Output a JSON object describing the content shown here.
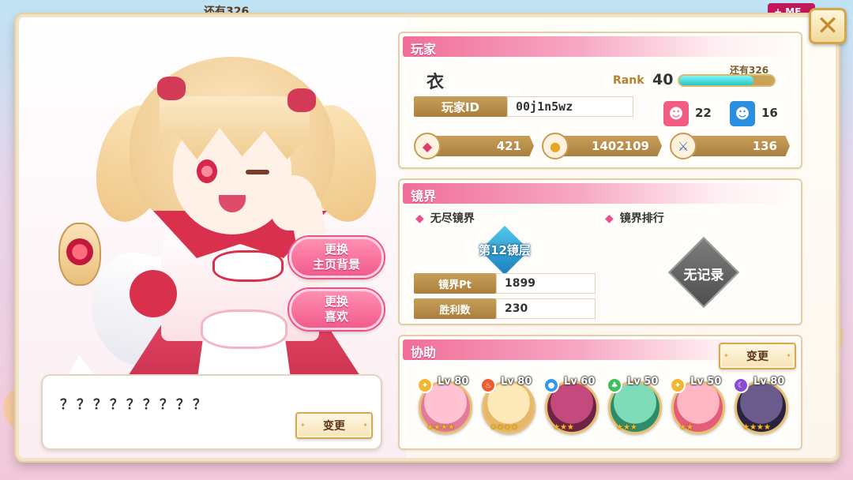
{
  "top_peek": {
    "remain": "还有326",
    "menu": "+ ME"
  },
  "close_label": "✕",
  "left": {
    "buttons": {
      "change_bg": [
        "更换",
        "主页背景"
      ],
      "change_fav": [
        "更换",
        "喜欢"
      ]
    },
    "speech": {
      "text": "？？？？？？？？？",
      "change_label": "变更"
    }
  },
  "player": {
    "header": "玩家",
    "name": "衣",
    "rank_label": "Rank",
    "rank_value": "40",
    "exp_remain": "还有326",
    "exp_progress": 0.78,
    "id_label": "玩家ID",
    "id_value": "00j1n5wz",
    "follow_count": "22",
    "follower_count": "16",
    "currencies": [
      {
        "icon": "gem-icon",
        "value": "421"
      },
      {
        "icon": "coin-icon",
        "value": "1402109"
      },
      {
        "icon": "sword-medal-icon",
        "value": "136"
      }
    ]
  },
  "mirror": {
    "header": "镜界",
    "endless_title": "无尽镜界",
    "ranking_title": "镜界排行",
    "floor_badge": "第12镜层",
    "stats": [
      {
        "label": "镜界Pt",
        "value": "1899"
      },
      {
        "label": "胜利数",
        "value": "230"
      }
    ],
    "no_record": "无记录"
  },
  "support": {
    "header": "协助",
    "change_label": "变更",
    "members": [
      {
        "attr": "light",
        "attr_color": "#f2b632",
        "lv": "Lv 80",
        "stars": "★★★★",
        "colors": [
          "#ffc3d3",
          "#e27b98"
        ]
      },
      {
        "attr": "fire",
        "attr_color": "#ef5a2f",
        "lv": "Lv 80",
        "stars": "★★★★",
        "colors": [
          "#fde9b7",
          "#e8b86a"
        ]
      },
      {
        "attr": "water",
        "attr_color": "#2f9be8",
        "lv": "Lv 60",
        "stars": "★★★",
        "colors": [
          "#c44a7e",
          "#6e2346"
        ]
      },
      {
        "attr": "forest",
        "attr_color": "#3fbf5a",
        "lv": "Lv 50",
        "stars": "★★★",
        "colors": [
          "#7fdcb8",
          "#2c8c6c"
        ]
      },
      {
        "attr": "light",
        "attr_color": "#f2b632",
        "lv": "Lv 50",
        "stars": "★★",
        "colors": [
          "#ffb6c5",
          "#e35d79"
        ]
      },
      {
        "attr": "dark",
        "attr_color": "#8a4bd6",
        "lv": "Lv 80",
        "stars": "★★★★",
        "colors": [
          "#6b5a8c",
          "#2a2340"
        ]
      }
    ]
  }
}
